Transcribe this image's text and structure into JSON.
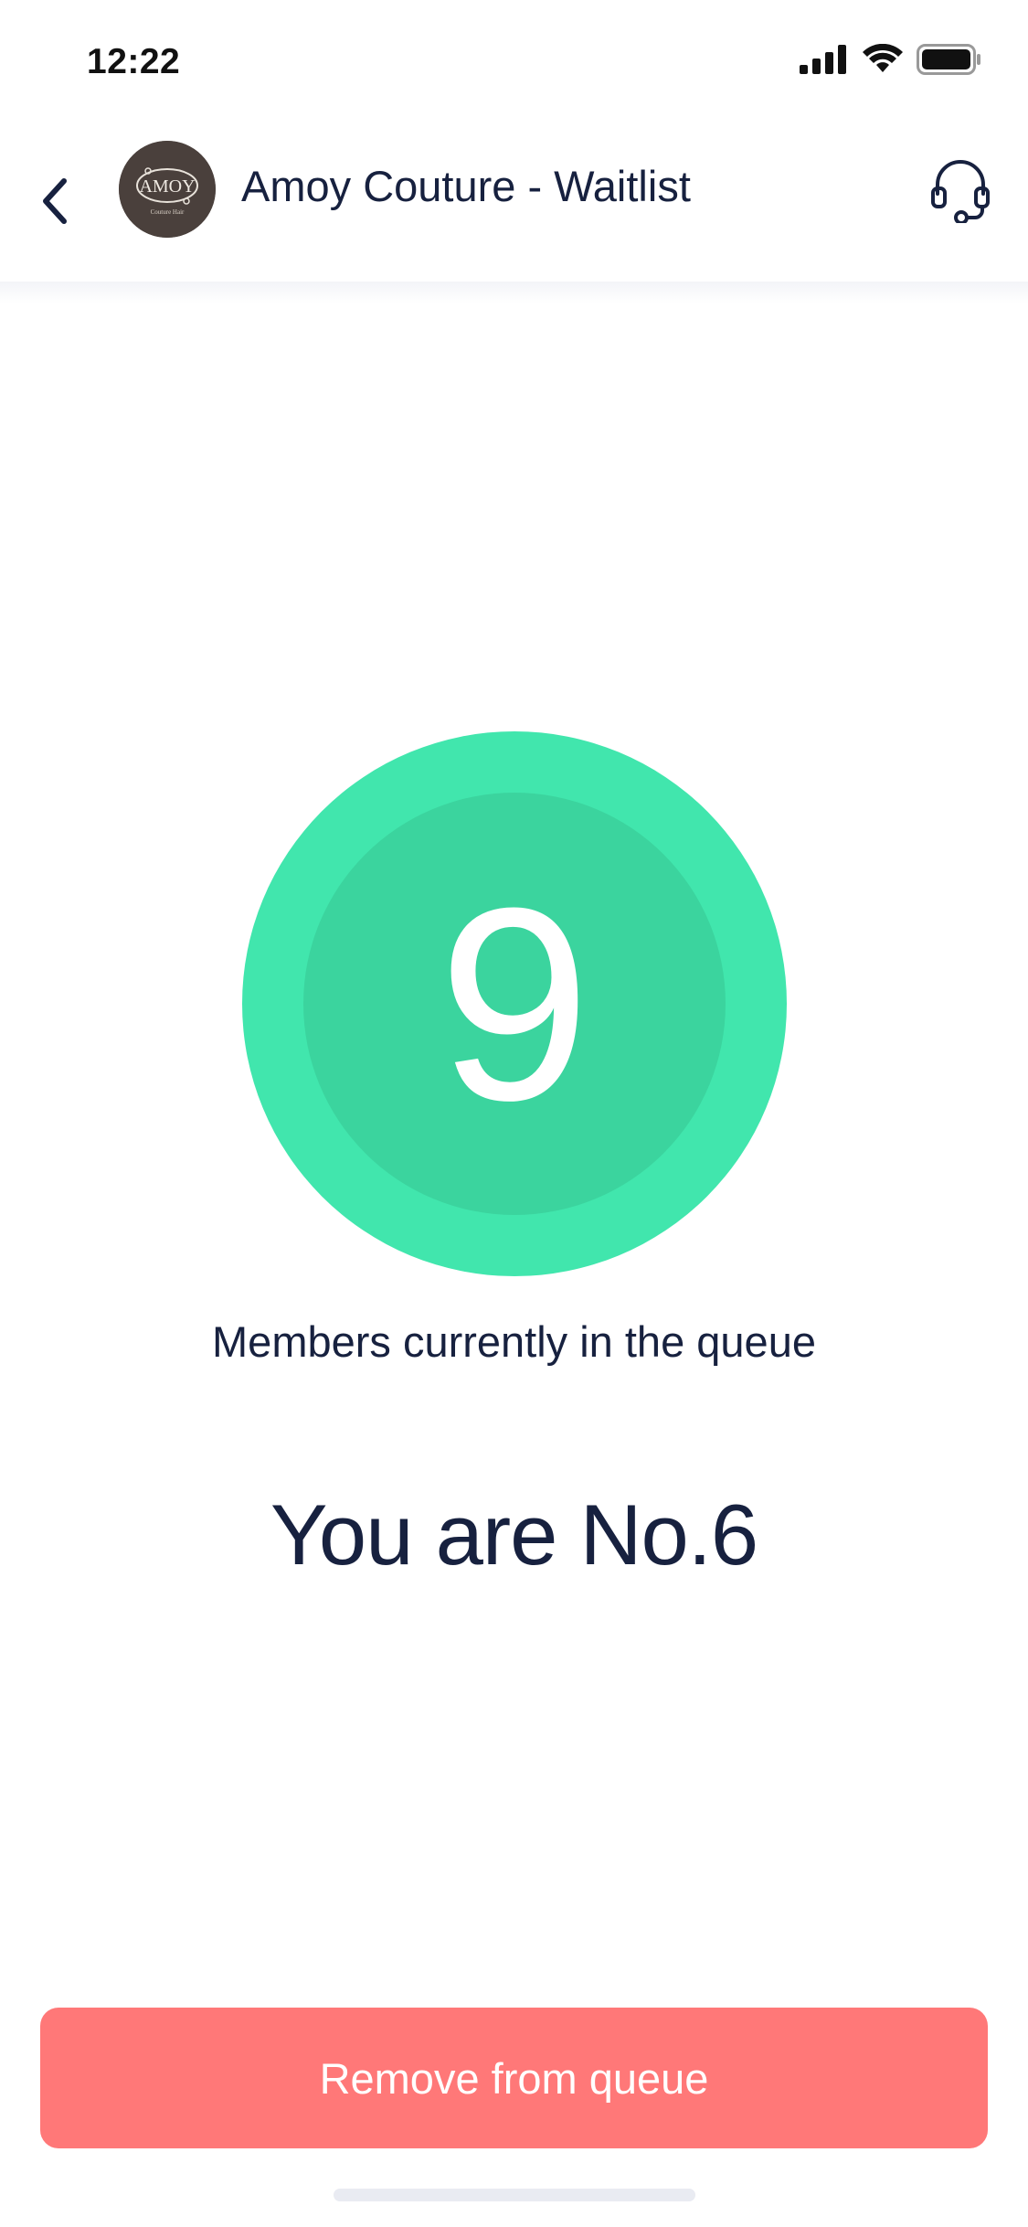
{
  "status_bar": {
    "time": "12:22"
  },
  "header": {
    "title": "Amoy Couture - Waitlist",
    "avatar": {
      "logo_text": "AMOY",
      "logo_subtext": "Couture Hair",
      "color": "#4a403c"
    },
    "back_icon": "chevron-left-icon",
    "support_icon": "headset-icon"
  },
  "queue": {
    "members_count": "9",
    "members_label": "Members currently in the queue",
    "position_text": "You are No.6"
  },
  "actions": {
    "remove_label": "Remove from queue"
  },
  "colors": {
    "circle_outer": "#41e6ad",
    "circle_inner": "#3bd49e",
    "remove_button": "#ff7878",
    "text_primary": "#17213f"
  }
}
